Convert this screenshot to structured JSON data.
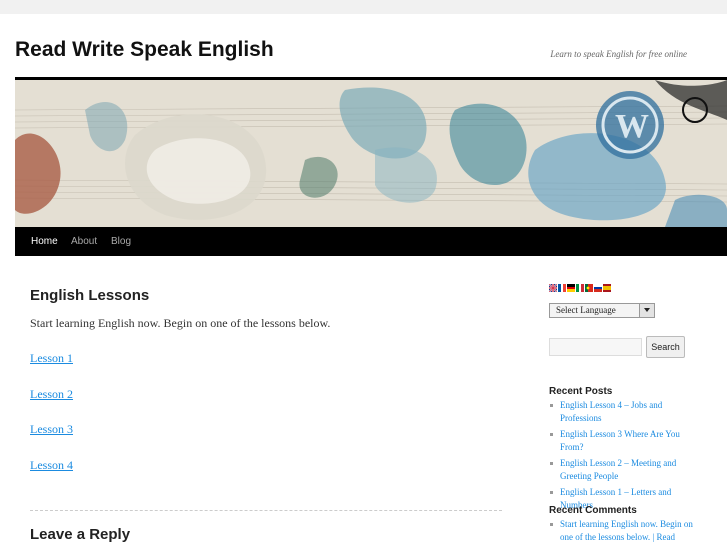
{
  "site": {
    "title": "Read Write Speak English",
    "description": "Learn to speak English for free online"
  },
  "nav": {
    "items": [
      {
        "label": "Home",
        "active": true
      },
      {
        "label": "About",
        "active": false
      },
      {
        "label": "Blog",
        "active": false
      }
    ]
  },
  "page": {
    "title": "English Lessons",
    "intro": "Start learning English now. Begin on one of the lessons below.",
    "lessons": [
      "Lesson 1",
      "Lesson 2",
      "Lesson 3",
      "Lesson 4"
    ],
    "reply_title": "Leave a Reply"
  },
  "sidebar": {
    "translate_flags": [
      "english-flag",
      "french-flag",
      "german-flag",
      "italian-flag",
      "portuguese-flag",
      "russian-flag",
      "spanish-flag"
    ],
    "language_select": {
      "selected": "Select Language"
    },
    "search": {
      "placeholder": "",
      "button_label": "Search"
    },
    "recent_posts": {
      "title": "Recent Posts",
      "items": [
        "English Lesson 4 – Jobs and Professions",
        "English Lesson 3 Where Are You From?",
        "English Lesson 2 – Meeting and Greeting People",
        "English Lesson 1 – Letters and Numbers"
      ]
    },
    "recent_comments": {
      "title": "Recent Comments",
      "items": [
        "Start learning English now. Begin on one of the lessons below. | Read"
      ]
    }
  },
  "colors": {
    "link": "#1b8be0",
    "nav_background": "#000000",
    "page_background": "#f1f1f1"
  }
}
